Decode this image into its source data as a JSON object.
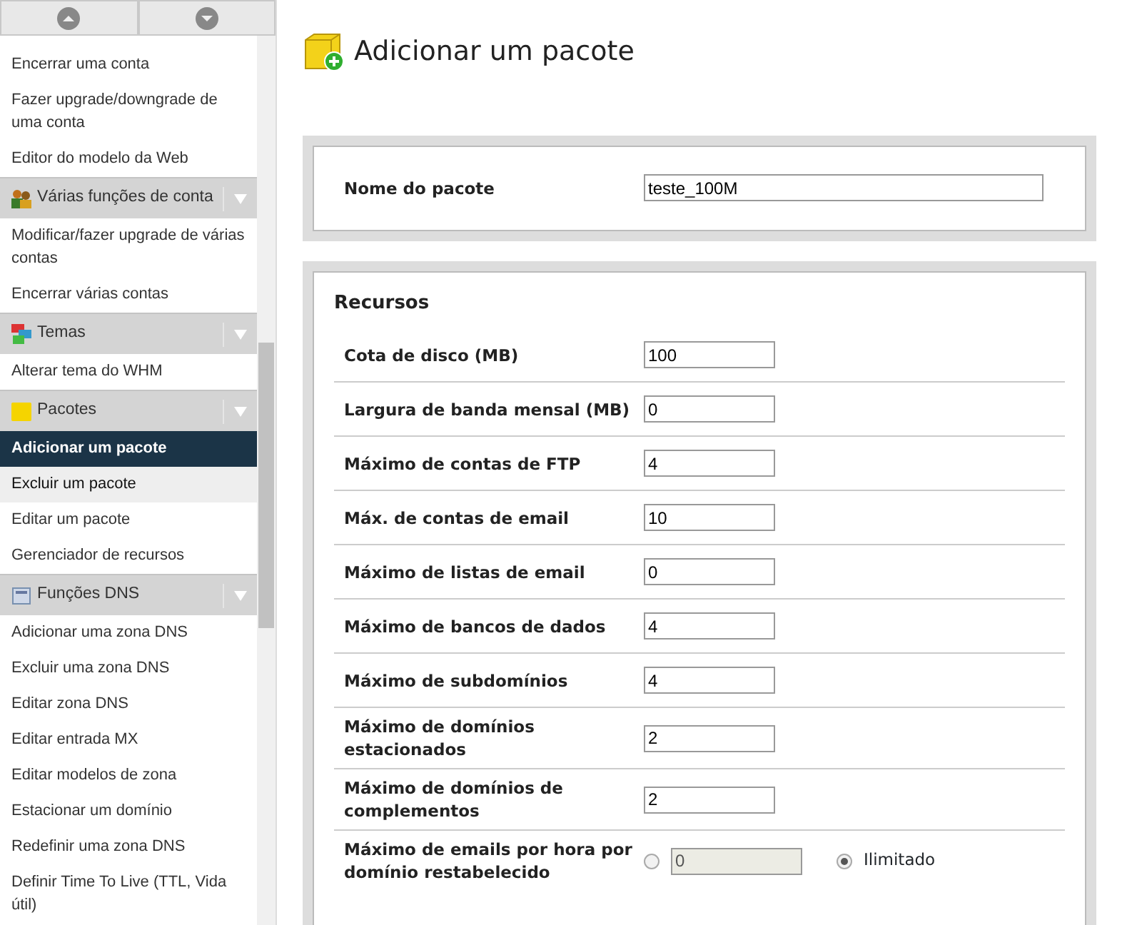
{
  "sidebar": {
    "items": [
      {
        "kind": "link",
        "label": "Encerrar uma conta",
        "selected": false,
        "hovered": false
      },
      {
        "kind": "link",
        "label": "Fazer upgrade/downgrade de uma conta",
        "selected": false,
        "hovered": false
      },
      {
        "kind": "link",
        "label": "Editor do modelo da Web",
        "selected": false,
        "hovered": false
      },
      {
        "kind": "header",
        "label": "Várias funções de conta"
      },
      {
        "kind": "link",
        "label": "Modificar/fazer upgrade de várias contas",
        "selected": false,
        "hovered": false
      },
      {
        "kind": "link",
        "label": "Encerrar várias contas",
        "selected": false,
        "hovered": false
      },
      {
        "kind": "header",
        "label": "Temas"
      },
      {
        "kind": "link",
        "label": "Alterar tema do WHM",
        "selected": false,
        "hovered": false
      },
      {
        "kind": "header",
        "label": "Pacotes"
      },
      {
        "kind": "link",
        "label": "Adicionar um pacote",
        "selected": true,
        "hovered": false
      },
      {
        "kind": "link",
        "label": "Excluir um pacote",
        "selected": false,
        "hovered": true
      },
      {
        "kind": "link",
        "label": "Editar um pacote",
        "selected": false,
        "hovered": false
      },
      {
        "kind": "link",
        "label": "Gerenciador de recursos",
        "selected": false,
        "hovered": false
      },
      {
        "kind": "header",
        "label": "Funções DNS"
      },
      {
        "kind": "link",
        "label": "Adicionar uma zona DNS",
        "selected": false,
        "hovered": false
      },
      {
        "kind": "link",
        "label": "Excluir uma zona DNS",
        "selected": false,
        "hovered": false
      },
      {
        "kind": "link",
        "label": "Editar zona DNS",
        "selected": false,
        "hovered": false
      },
      {
        "kind": "link",
        "label": "Editar entrada MX",
        "selected": false,
        "hovered": false
      },
      {
        "kind": "link",
        "label": "Editar modelos de zona",
        "selected": false,
        "hovered": false
      },
      {
        "kind": "link",
        "label": "Estacionar um domínio",
        "selected": false,
        "hovered": false
      },
      {
        "kind": "link",
        "label": "Redefinir uma zona DNS",
        "selected": false,
        "hovered": false
      },
      {
        "kind": "link",
        "label": "Definir Time To Live (TTL, Vida útil)",
        "selected": false,
        "hovered": false
      }
    ]
  },
  "page": {
    "title": "Adicionar um pacote"
  },
  "package_name": {
    "label": "Nome do pacote",
    "value": "teste_100M"
  },
  "resources": {
    "title": "Recursos",
    "rows": [
      {
        "kind": "text",
        "label": "Cota de disco (MB)",
        "value": "100"
      },
      {
        "kind": "text",
        "label": "Largura de banda mensal (MB)",
        "value": "0"
      },
      {
        "kind": "text",
        "label": "Máximo de contas de FTP",
        "value": "4"
      },
      {
        "kind": "text",
        "label": "Máx. de contas de email",
        "value": "10"
      },
      {
        "kind": "text",
        "label": "Máximo de listas de email",
        "value": "0"
      },
      {
        "kind": "text",
        "label": "Máximo de bancos de dados",
        "value": "4"
      },
      {
        "kind": "text",
        "label": "Máximo de subdomínios",
        "value": "4"
      },
      {
        "kind": "text",
        "label": "Máximo de domínios estacionados",
        "value": "2"
      },
      {
        "kind": "text",
        "label": "Máximo de domínios de complementos",
        "value": "2"
      },
      {
        "kind": "limit",
        "label": "Máximo de emails por hora por domínio restabelecido",
        "value": "0",
        "unlimited_label": "Ilimitado",
        "unlimited": true
      }
    ]
  }
}
